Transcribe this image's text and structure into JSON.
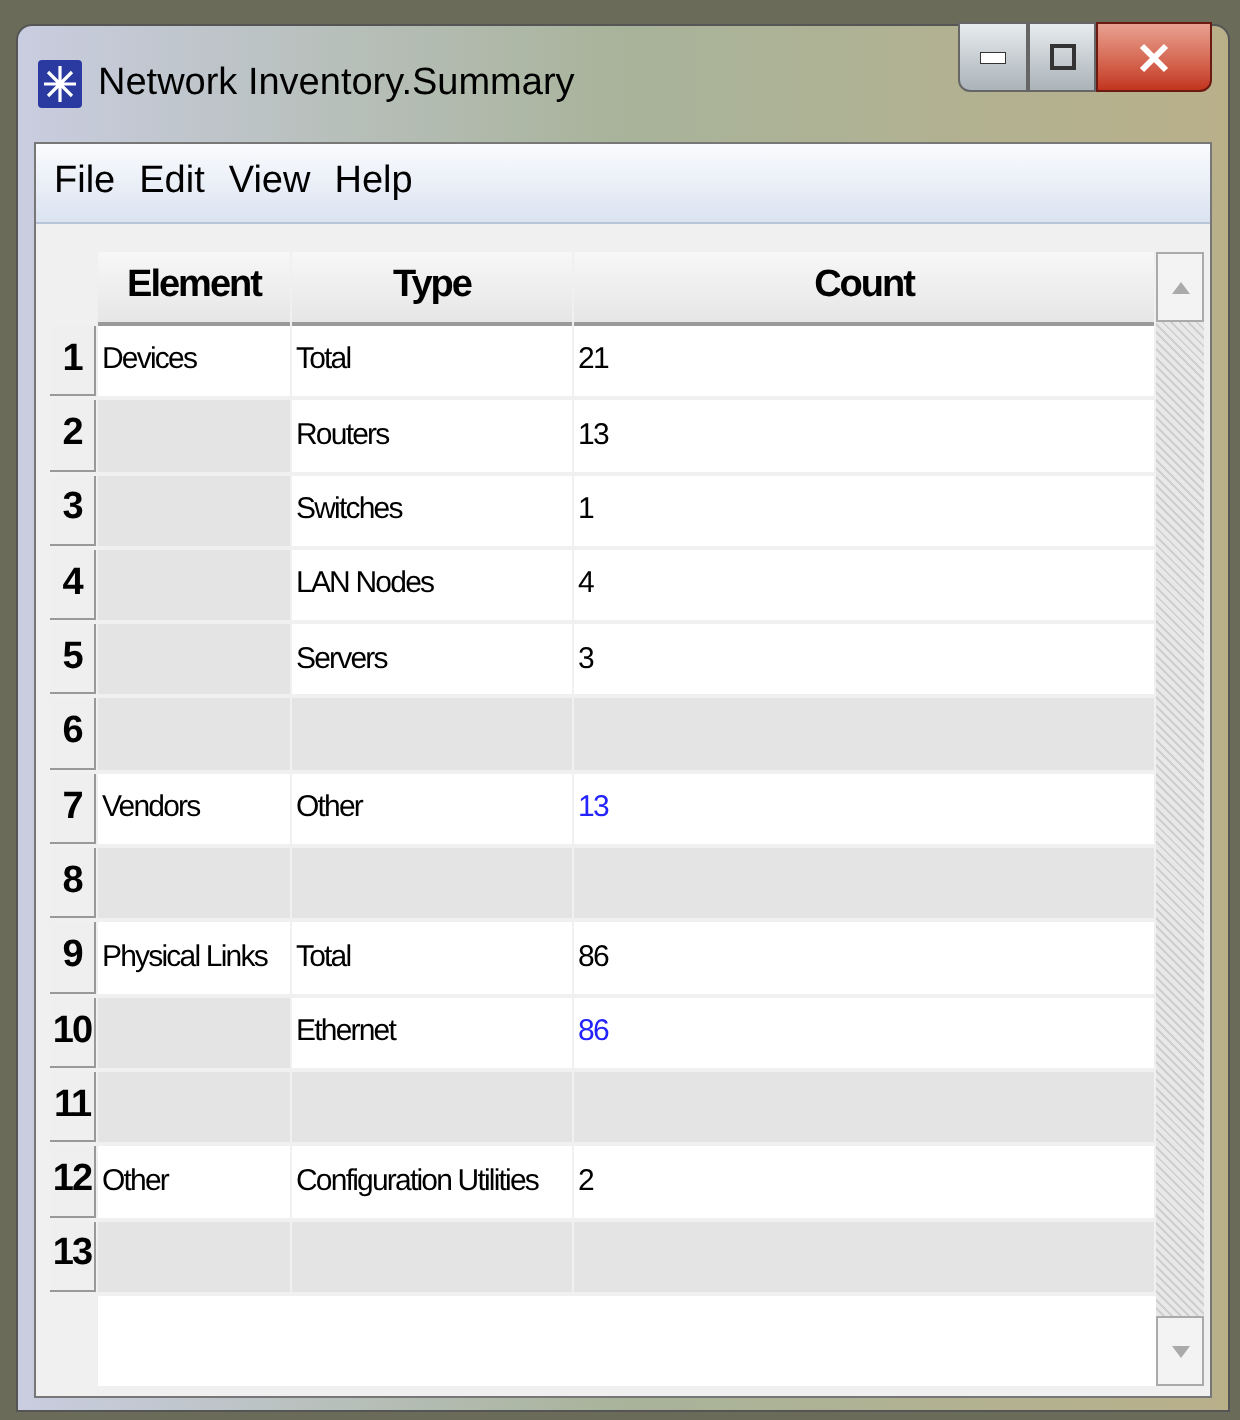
{
  "window": {
    "title": "Network Inventory.Summary"
  },
  "menu": [
    "File",
    "Edit",
    "View",
    "Help"
  ],
  "table": {
    "columns": [
      "Element",
      "Type",
      "Count"
    ],
    "rows": [
      {
        "number": "1",
        "element": "Devices",
        "type": "Total",
        "count": "21",
        "count_link": false
      },
      {
        "number": "2",
        "type": "Routers",
        "count": "13",
        "count_link": false
      },
      {
        "number": "3",
        "type": "Switches",
        "count": "1",
        "count_link": false
      },
      {
        "number": "4",
        "type": "LAN Nodes",
        "count": "4",
        "count_link": false
      },
      {
        "number": "5",
        "type": "Servers",
        "count": "3",
        "count_link": false
      },
      {
        "number": "6"
      },
      {
        "number": "7",
        "element": "Vendors",
        "type": "Other",
        "count": "13",
        "count_link": true
      },
      {
        "number": "8"
      },
      {
        "number": "9",
        "element": "Physical Links",
        "type": "Total",
        "count": "86",
        "count_link": false
      },
      {
        "number": "10",
        "type": "Ethernet",
        "count": "86",
        "count_link": true
      },
      {
        "number": "11"
      },
      {
        "number": "12",
        "element": "Other",
        "type": "Configuration Utilities",
        "count": "2",
        "count_link": false
      },
      {
        "number": "13"
      }
    ]
  }
}
